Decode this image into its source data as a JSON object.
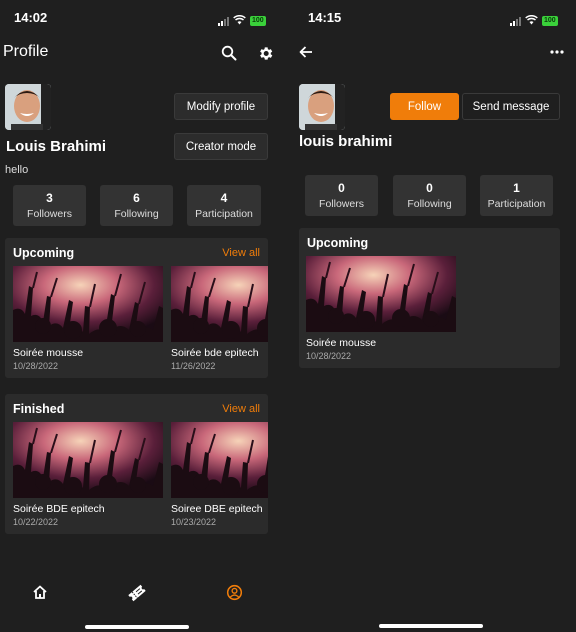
{
  "left": {
    "status_time": "14:02",
    "battery": "100",
    "header_title": "Profile",
    "modify_profile_label": "Modify profile",
    "creator_mode_label": "Creator mode",
    "name": "Louis Brahimi",
    "bio": "hello",
    "stats": [
      {
        "value": "3",
        "label": "Followers"
      },
      {
        "value": "6",
        "label": "Following"
      },
      {
        "value": "4",
        "label": "Participation"
      }
    ],
    "upcoming": {
      "title": "Upcoming",
      "view_all": "View all",
      "events": [
        {
          "title": "Soirée mousse",
          "date": "10/28/2022"
        },
        {
          "title": "Soirée bde epitech",
          "date": "11/26/2022"
        }
      ]
    },
    "finished": {
      "title": "Finished",
      "view_all": "View all",
      "events": [
        {
          "title": "Soirée BDE epitech",
          "date": "10/22/2022"
        },
        {
          "title": "Soiree DBE epitech",
          "date": "10/23/2022"
        }
      ]
    },
    "tabs": [
      {
        "icon": "home-icon"
      },
      {
        "icon": "ticket-icon"
      },
      {
        "icon": "profile-icon",
        "active": true
      }
    ]
  },
  "right": {
    "status_time": "14:15",
    "battery": "100",
    "follow_label": "Follow",
    "send_message_label": "Send message",
    "name": "louis brahimi",
    "stats": [
      {
        "value": "0",
        "label": "Followers"
      },
      {
        "value": "0",
        "label": "Following"
      },
      {
        "value": "1",
        "label": "Participation"
      }
    ],
    "upcoming": {
      "title": "Upcoming",
      "events": [
        {
          "title": "Soirée mousse",
          "date": "10/28/2022"
        }
      ]
    }
  },
  "colors": {
    "accent": "#f07d0a",
    "background": "#1f1f1f",
    "card": "#2b2b2b",
    "stat": "#333333"
  }
}
